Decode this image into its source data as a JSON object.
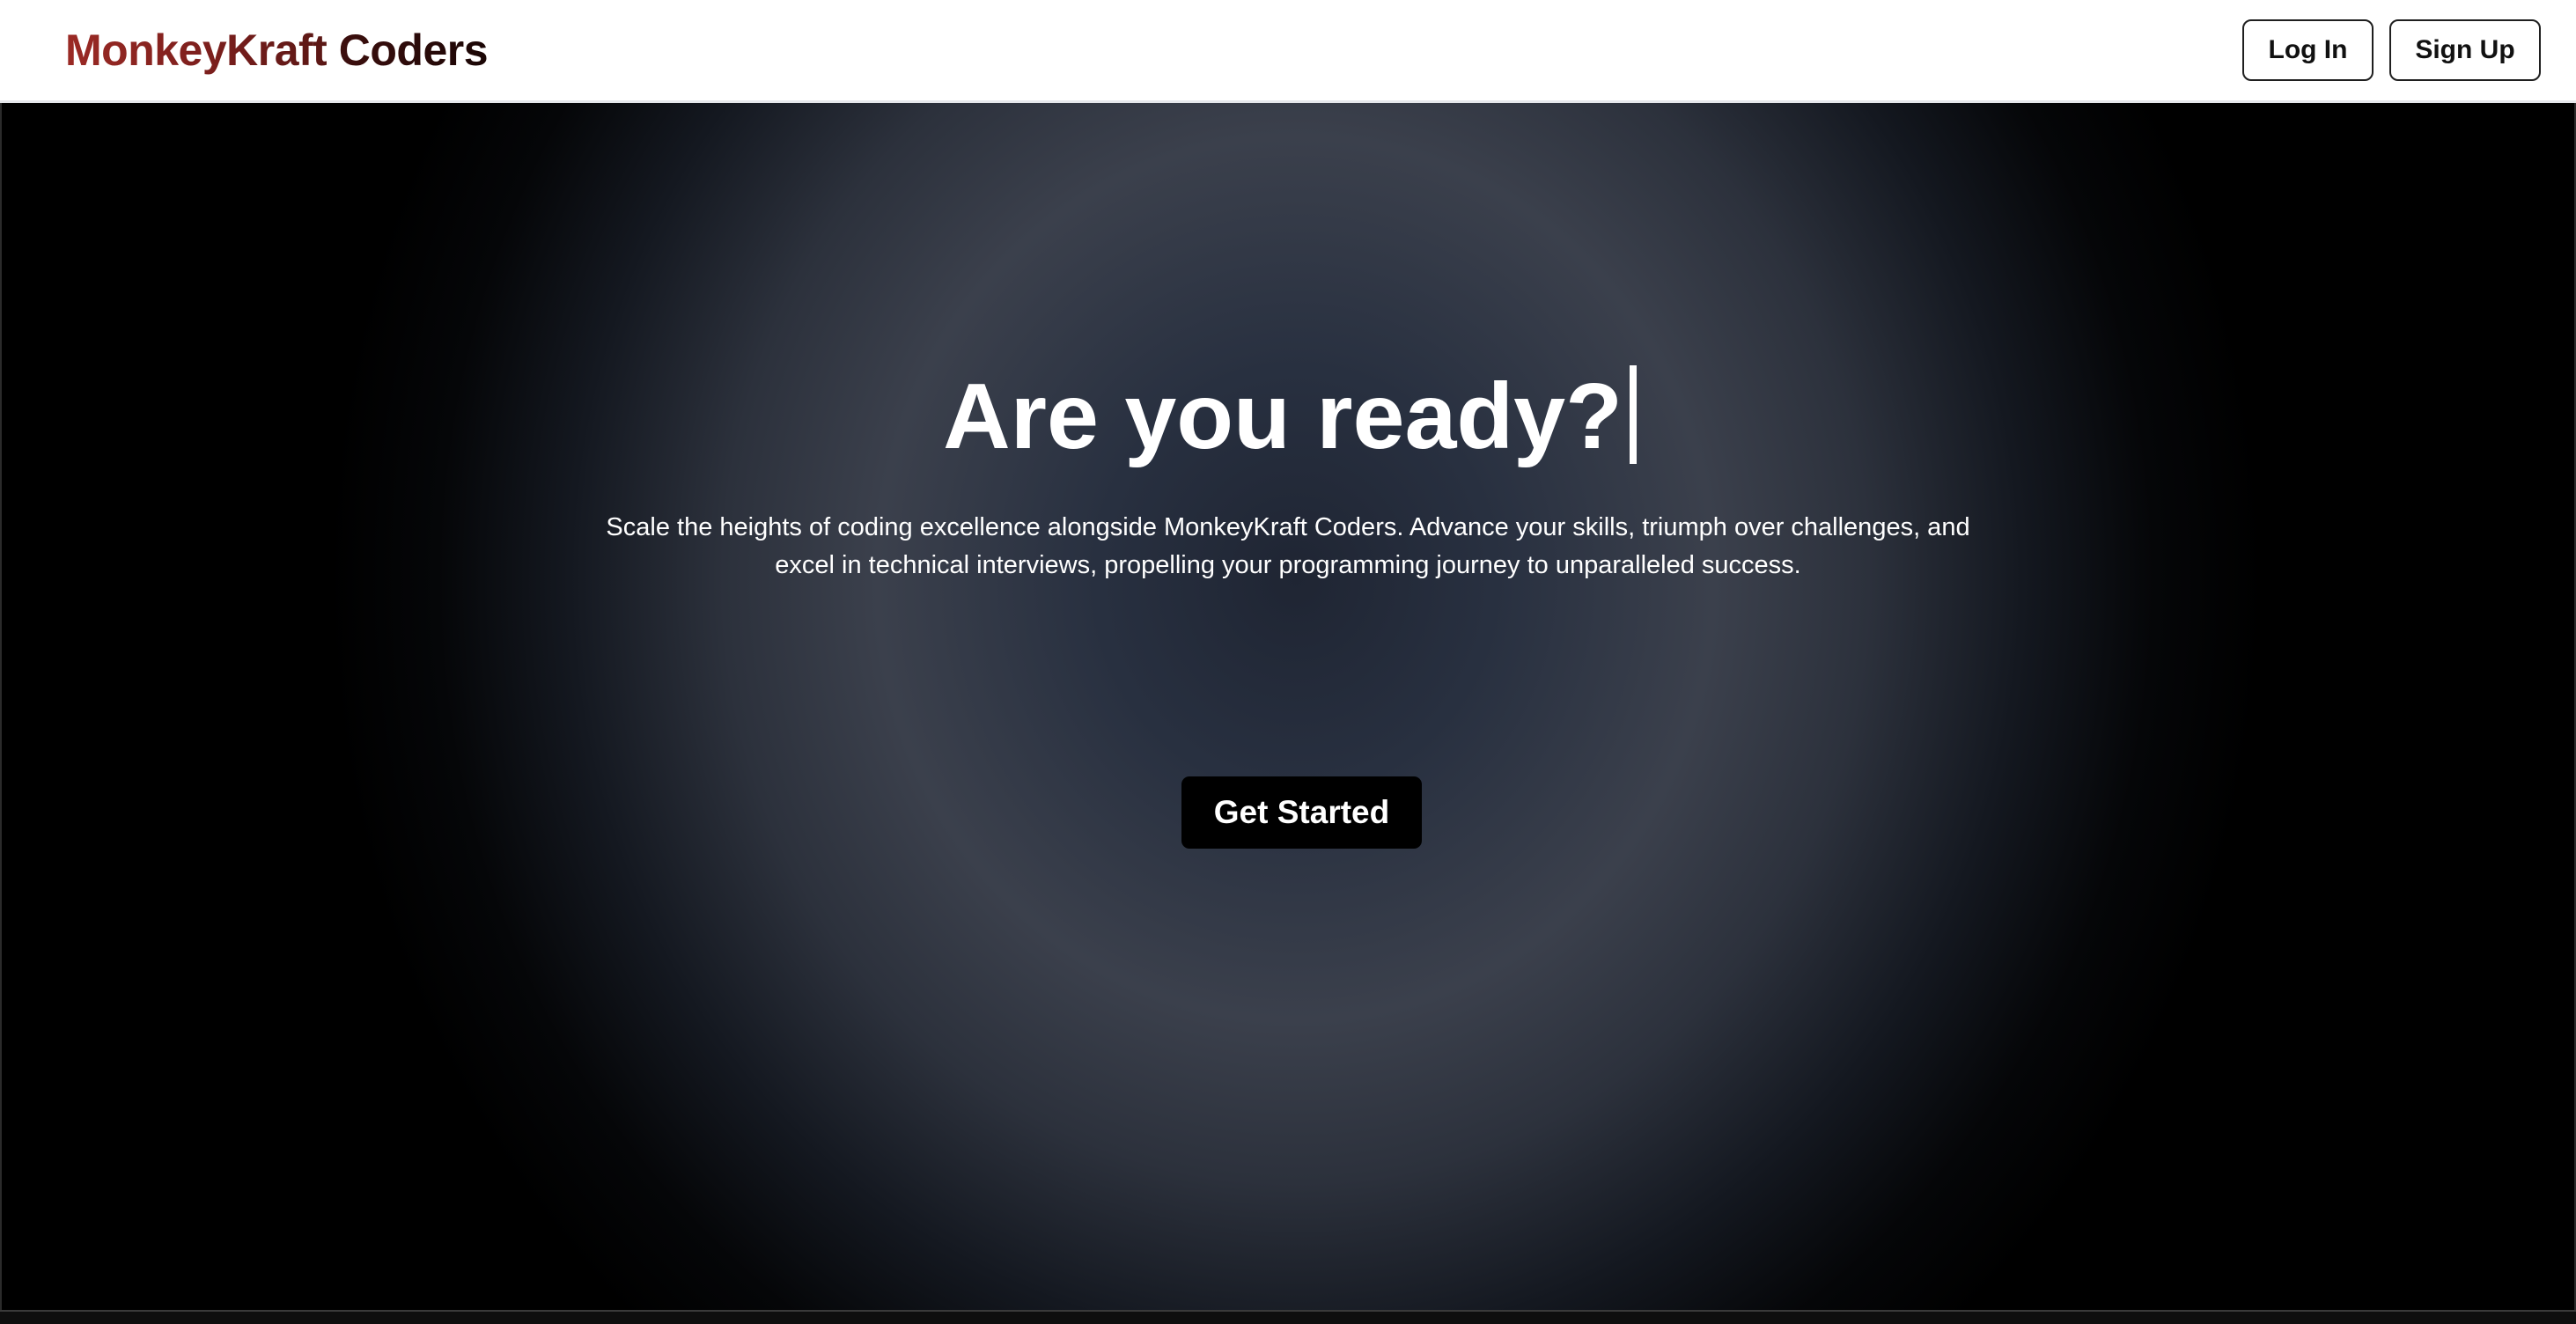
{
  "header": {
    "brand_part1": "MonkeyKraft",
    "brand_part2": "Coders",
    "login_label": "Log In",
    "signup_label": "Sign Up"
  },
  "hero": {
    "headline": "Are you ready?",
    "subtitle": "Scale the heights of coding excellence alongside MonkeyKraft Coders. Advance your skills, triumph over challenges, and excel in technical interviews, propelling your programming journey to unparalleled success.",
    "cta_label": "Get Started"
  },
  "colors": {
    "brand_red": "#9b2a25",
    "brand_dark": "#1a0605",
    "hero_center": "#3b404c",
    "hero_edge": "#000000",
    "cta_bg": "#000000"
  }
}
